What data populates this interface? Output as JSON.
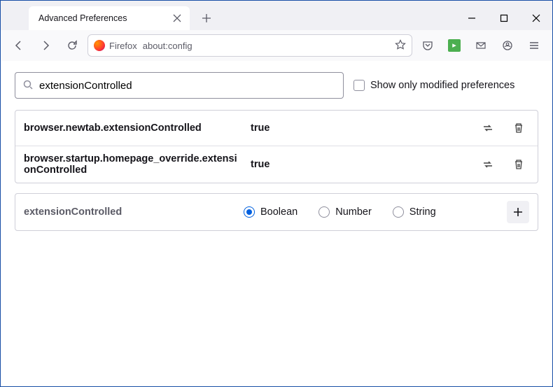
{
  "window": {
    "tab_title": "Advanced Preferences"
  },
  "addressbar": {
    "identity_label": "Firefox",
    "url": "about:config"
  },
  "search": {
    "value": "extensionControlled",
    "checkbox_label": "Show only modified preferences"
  },
  "prefs": [
    {
      "name": "browser.newtab.extensionControlled",
      "value": "true"
    },
    {
      "name": "browser.startup.homepage_override.extensionControlled",
      "value": "true"
    }
  ],
  "new_pref": {
    "name": "extensionControlled",
    "types": [
      "Boolean",
      "Number",
      "String"
    ],
    "selected_type": "Boolean"
  }
}
